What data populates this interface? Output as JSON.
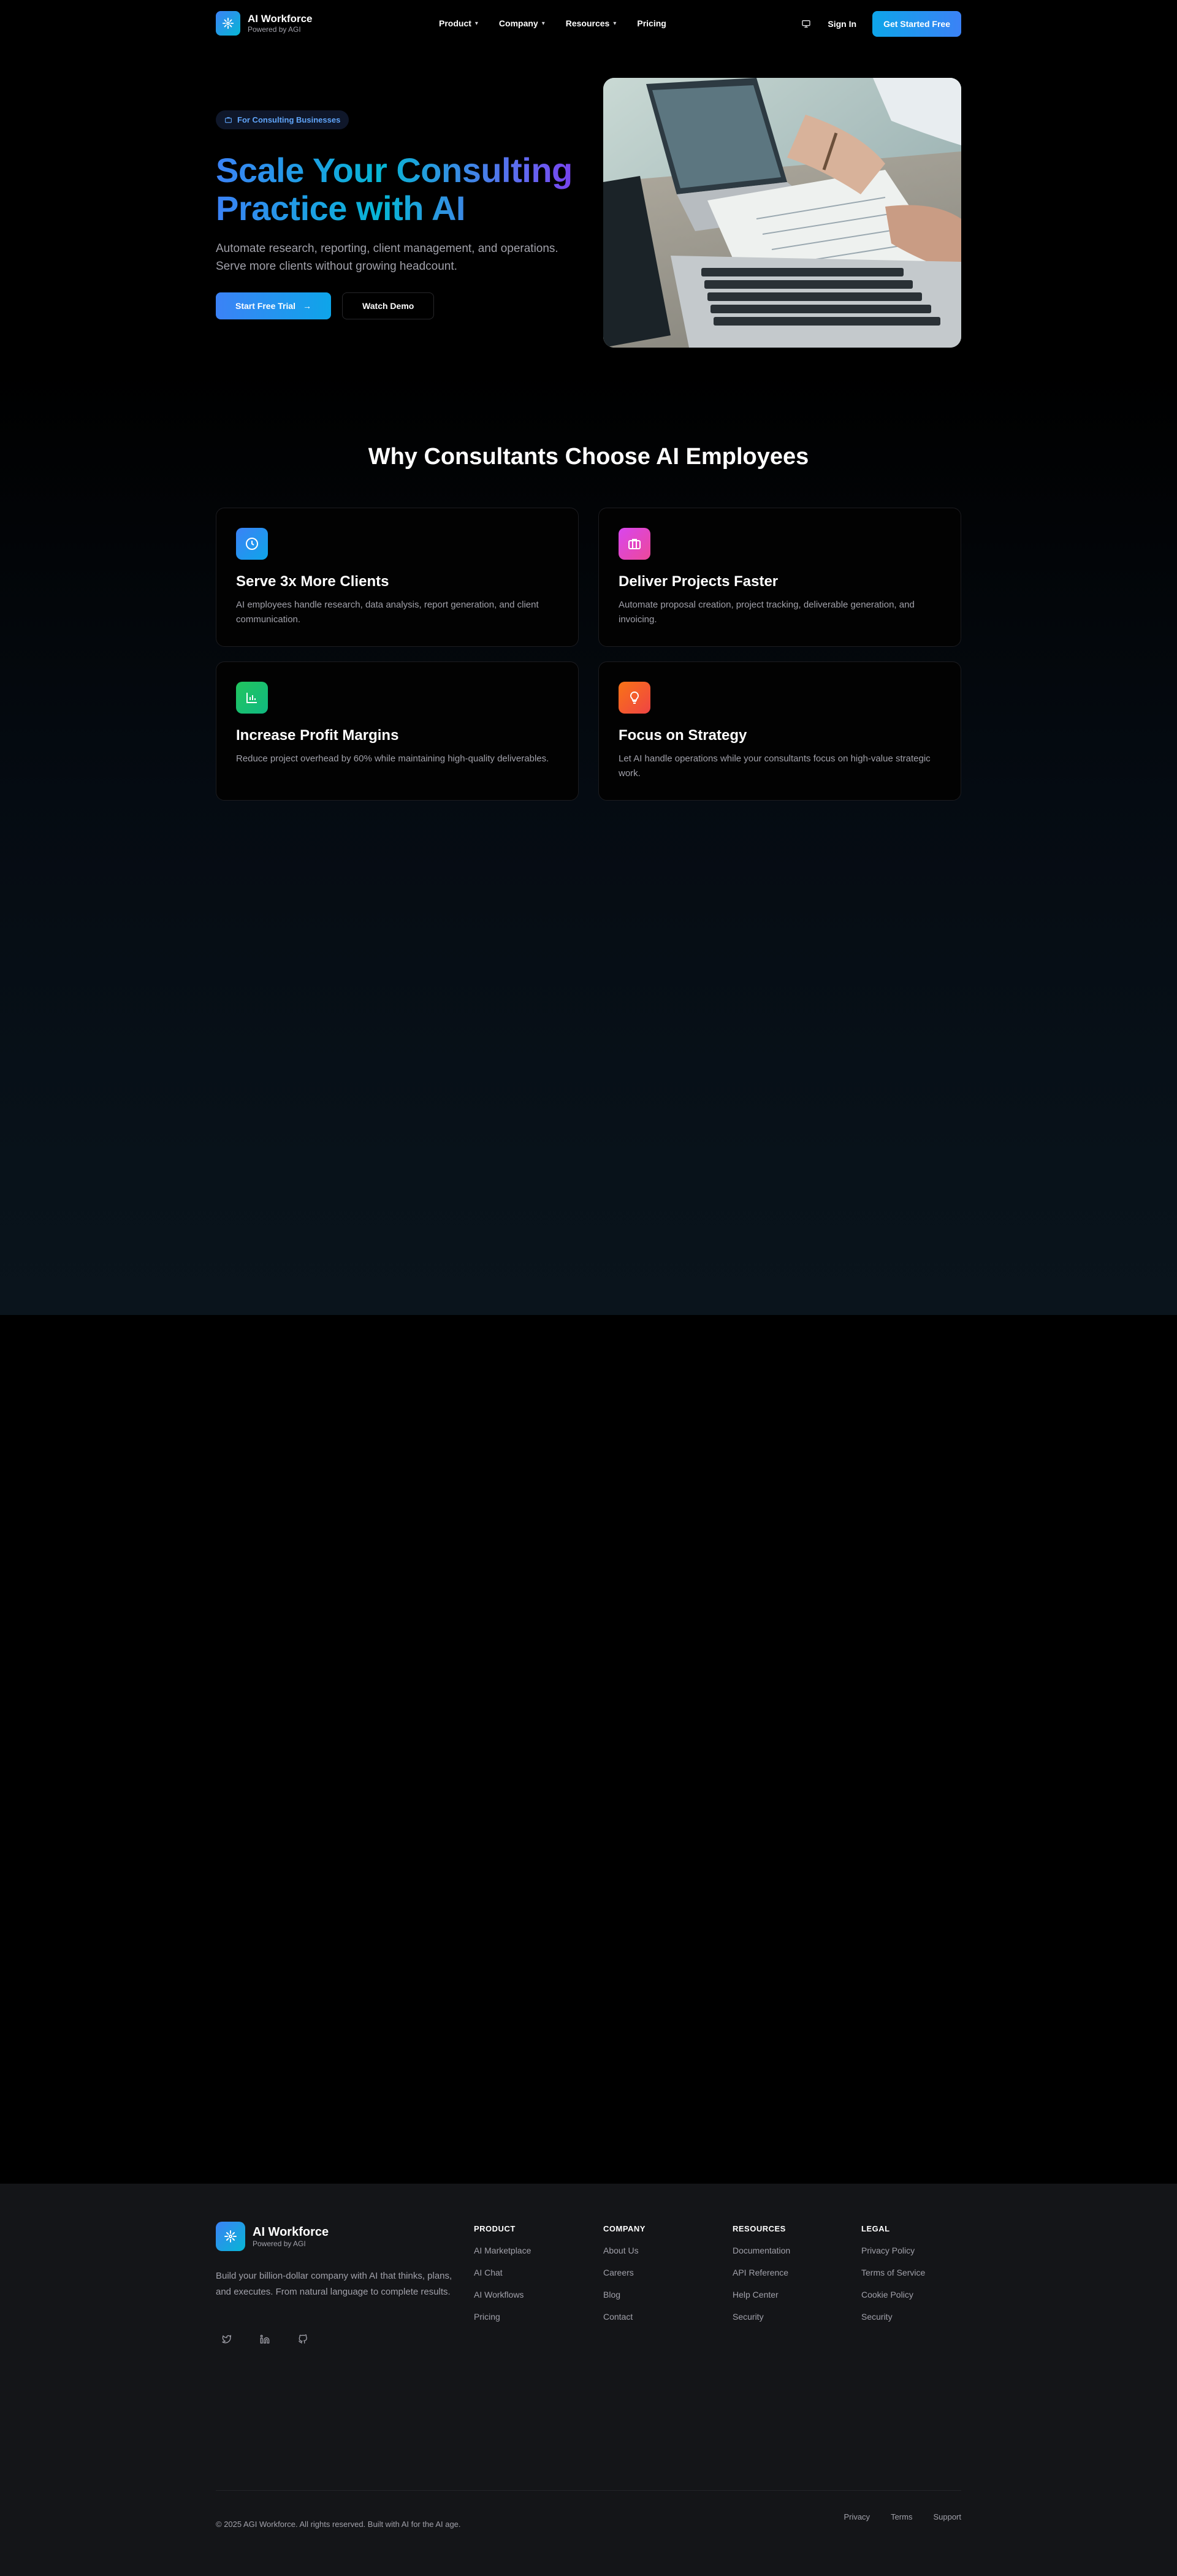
{
  "brand": {
    "name": "AI Workforce",
    "tagline": "Powered by AGI"
  },
  "nav": {
    "items": [
      {
        "label": "Product",
        "has_dropdown": true
      },
      {
        "label": "Company",
        "has_dropdown": true
      },
      {
        "label": "Resources",
        "has_dropdown": true
      },
      {
        "label": "Pricing",
        "has_dropdown": false
      }
    ],
    "theme_icon": "monitor-icon",
    "sign_in": "Sign In",
    "get_started": "Get Started Free"
  },
  "hero": {
    "badge": "For Consulting Businesses",
    "title": "Scale Your Consulting Practice with AI",
    "description": "Automate research, reporting, client management, and operations. Serve more clients without growing headcount.",
    "primary_cta": "Start Free Trial",
    "secondary_cta": "Watch Demo"
  },
  "why": {
    "title": "Why Consultants Choose AI Employees",
    "cards": [
      {
        "icon": "clock-icon",
        "color": "#2563eb",
        "title": "Serve 3x More Clients",
        "desc": "AI employees handle research, data analysis, report generation, and client communication."
      },
      {
        "icon": "briefcase-icon",
        "color": "#c026d3",
        "title": "Deliver Projects Faster",
        "desc": "Automate proposal creation, project tracking, deliverable generation, and invoicing."
      },
      {
        "icon": "bar-chart-icon",
        "color": "#16a34a",
        "title": "Increase Profit Margins",
        "desc": "Reduce project overhead by 60% while maintaining high-quality deliverables."
      },
      {
        "icon": "lightbulb-icon",
        "color": "#ea580c",
        "title": "Focus on Strategy",
        "desc": "Let AI handle operations while your consultants focus on high-value strategic work."
      }
    ]
  },
  "footer": {
    "brand_name": "AI Workforce",
    "brand_tagline": "Powered by AGI",
    "description": "Build your billion-dollar company with AI that thinks, plans, and executes. From natural language to complete results.",
    "columns": [
      {
        "title": "PRODUCT",
        "links": [
          "AI Marketplace",
          "AI Chat",
          "AI Workflows",
          "Pricing"
        ]
      },
      {
        "title": "COMPANY",
        "links": [
          "About Us",
          "Careers",
          "Blog",
          "Contact"
        ]
      },
      {
        "title": "RESOURCES",
        "links": [
          "Documentation",
          "API Reference",
          "Help Center",
          "Security"
        ]
      },
      {
        "title": "LEGAL",
        "links": [
          "Privacy Policy",
          "Terms of Service",
          "Cookie Policy",
          "Security"
        ]
      }
    ],
    "copyright": "© 2025 AGI Workforce. All rights reserved. Built with AI for the AI age.",
    "bottom_links": [
      "Privacy",
      "Terms",
      "Support"
    ]
  }
}
